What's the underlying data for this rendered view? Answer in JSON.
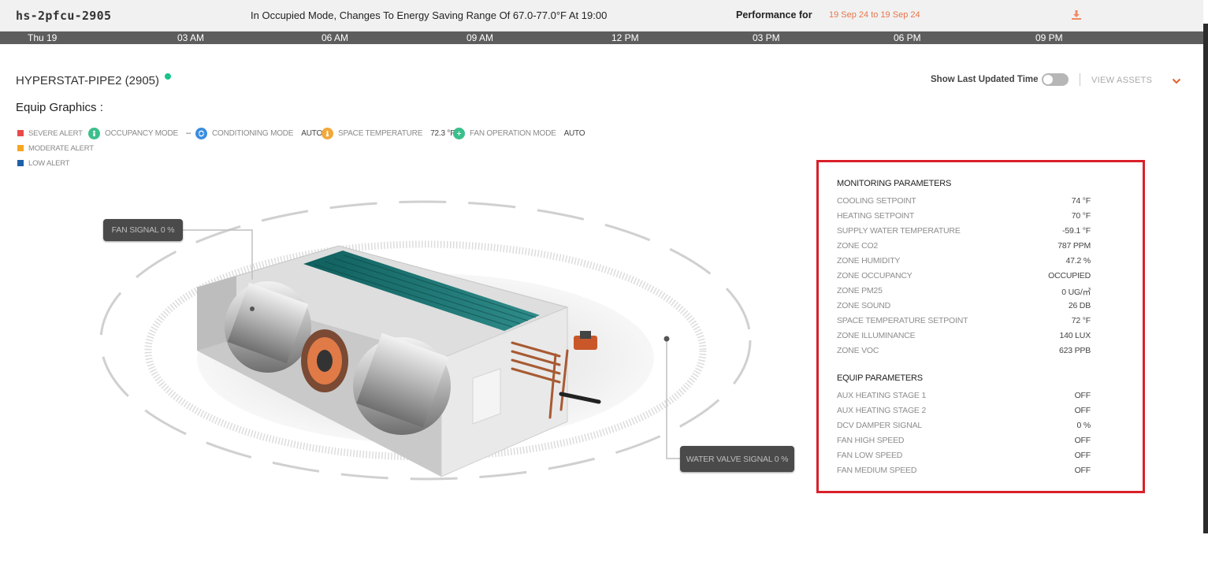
{
  "header": {
    "site_name": "hs-2pfcu-2905",
    "schedule_message": "In Occupied Mode, Changes To Energy Saving Range Of 67.0-77.0°F At 19:00",
    "performance_label": "Performance for",
    "performance_range": "19 Sep 24 to 19 Sep 24",
    "download_icon": "download-icon"
  },
  "timeline": {
    "ticks": [
      "Thu 19",
      "03 AM",
      "06 AM",
      "09 AM",
      "12 PM",
      "03 PM",
      "06 PM",
      "09 PM"
    ]
  },
  "equip": {
    "title": "HYPERSTAT-PIPE2 (2905)",
    "status_color": "#19c38a",
    "graphics_label": "Equip Graphics :",
    "show_last_updated_label": "Show Last Updated Time",
    "show_last_updated_on": false,
    "view_assets_label": "VIEW ASSETS"
  },
  "legend": [
    {
      "label": "SEVERE ALERT",
      "color": "#e84b4b"
    },
    {
      "label": "MODERATE ALERT",
      "color": "#f5a623"
    },
    {
      "label": "LOW ALERT",
      "color": "#1f5fa8"
    }
  ],
  "status": [
    {
      "label": "OCCUPANCY MODE",
      "value": "--",
      "color": "#3bbf8c",
      "icon": "occupancy-icon"
    },
    {
      "label": "CONDITIONING MODE",
      "value": "AUTO",
      "color": "#3c8de0",
      "icon": "conditioning-icon"
    },
    {
      "label": "SPACE TEMPERATURE",
      "value": "72.3 °F",
      "color": "#f2a83b",
      "icon": "thermometer-icon"
    },
    {
      "label": "FAN OPERATION MODE",
      "value": "AUTO",
      "color": "#3bbf8c",
      "icon": "fan-icon"
    }
  ],
  "callouts": {
    "fan_signal": "FAN SIGNAL 0 %",
    "water_valve_signal": "WATER VALVE SIGNAL   0 %"
  },
  "monitoring": {
    "title": "MONITORING PARAMETERS",
    "rows": [
      {
        "label": "COOLING SETPOINT",
        "value": "74 °F"
      },
      {
        "label": "HEATING SETPOINT",
        "value": "70 °F"
      },
      {
        "label": "SUPPLY WATER TEMPERATURE",
        "value": "-59.1 °F"
      },
      {
        "label": "ZONE CO2",
        "value": "787 PPM"
      },
      {
        "label": "ZONE HUMIDITY",
        "value": "47.2 %"
      },
      {
        "label": "ZONE OCCUPANCY",
        "value": "OCCUPIED"
      },
      {
        "label": "ZONE PM25",
        "value": "0 UG/㎥"
      },
      {
        "label": "ZONE SOUND",
        "value": "26 DB"
      },
      {
        "label": "SPACE TEMPERATURE SETPOINT",
        "value": "72 °F"
      },
      {
        "label": "ZONE ILLUMINANCE",
        "value": "140 LUX"
      },
      {
        "label": "ZONE VOC",
        "value": "623 PPB"
      }
    ]
  },
  "equip_params": {
    "title": "EQUIP PARAMETERS",
    "rows": [
      {
        "label": "AUX HEATING STAGE 1",
        "value": "OFF"
      },
      {
        "label": "AUX HEATING STAGE 2",
        "value": "OFF"
      },
      {
        "label": "DCV DAMPER SIGNAL",
        "value": "0 %"
      },
      {
        "label": "FAN HIGH SPEED",
        "value": "OFF"
      },
      {
        "label": "FAN LOW SPEED",
        "value": "OFF"
      },
      {
        "label": "FAN MEDIUM SPEED",
        "value": "OFF"
      }
    ]
  }
}
